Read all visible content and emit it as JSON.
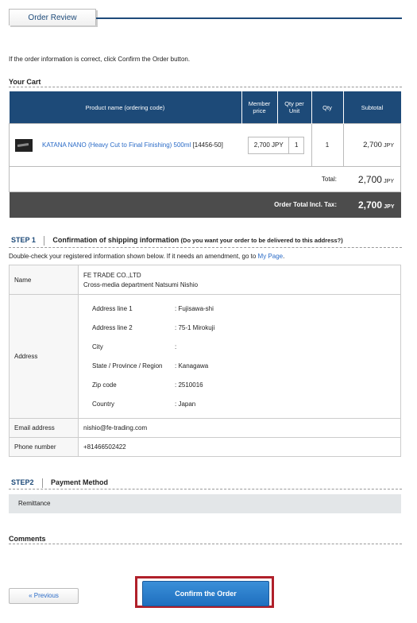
{
  "header": {
    "tab_label": "Order Review"
  },
  "intro": "If the order information is correct, click Confirm the Order button.",
  "cart": {
    "title": "Your Cart",
    "columns": [
      "Product name (ordering code)",
      "Member price",
      "Qty per Unit",
      "Qty",
      "Subtotal"
    ],
    "items": [
      {
        "name": "KATANA NANO (Heavy Cut to Final Finishing) 500ml",
        "code": "[14456-50]",
        "price": "2,700 JPY",
        "qty_per_unit": "1",
        "qty": "1",
        "subtotal_value": "2,700",
        "subtotal_unit": "JPY"
      }
    ],
    "total_label": "Total:",
    "total_value": "2,700",
    "total_unit": "JPY",
    "order_total_label": "Order Total Incl. Tax:",
    "order_total_value": "2,700",
    "order_total_unit": "JPY"
  },
  "step1": {
    "step": "STEP 1",
    "title": "Confirmation of shipping information",
    "subtitle": "(Do you want your order to be delivered to this address?)",
    "note_before": "Double-check your registered information shown below. If it needs an amendment, go to",
    "link": "My Page",
    "note_after": ".",
    "name_label": "Name",
    "name_line1": "FE TRADE CO.,LTD",
    "name_line2": "Cross-media department Natsumi Nishio",
    "address_label": "Address",
    "address": [
      {
        "label": "Address line 1",
        "value": ": Fujisawa-shi"
      },
      {
        "label": "Address line 2",
        "value": ": 75-1 Mirokuji"
      },
      {
        "label": "City",
        "value": ":"
      },
      {
        "label": "State / Province / Region",
        "value": ": Kanagawa"
      },
      {
        "label": "Zip code",
        "value": ": 2510016"
      },
      {
        "label": "Country",
        "value": ": Japan"
      }
    ],
    "email_label": "Email address",
    "email": "nishio@fe-trading.com",
    "phone_label": "Phone number",
    "phone": "+81466502422"
  },
  "step2": {
    "step": "STEP2",
    "title": "Payment Method",
    "method": "Remittance"
  },
  "comments": {
    "title": "Comments"
  },
  "buttons": {
    "previous": "« Previous",
    "confirm": "Confirm the Order"
  }
}
